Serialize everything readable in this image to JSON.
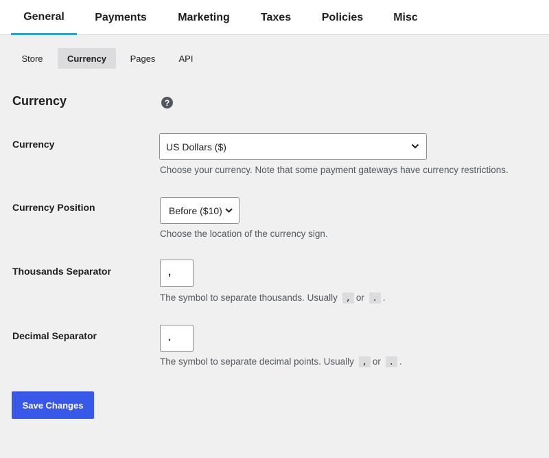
{
  "top_tabs": [
    {
      "label": "General",
      "active": true
    },
    {
      "label": "Payments",
      "active": false
    },
    {
      "label": "Marketing",
      "active": false
    },
    {
      "label": "Taxes",
      "active": false
    },
    {
      "label": "Policies",
      "active": false
    },
    {
      "label": "Misc",
      "active": false
    }
  ],
  "sub_tabs": [
    {
      "label": "Store",
      "active": false
    },
    {
      "label": "Currency",
      "active": true
    },
    {
      "label": "Pages",
      "active": false
    },
    {
      "label": "API",
      "active": false
    }
  ],
  "section": {
    "title": "Currency",
    "help_icon": "question-circle-icon"
  },
  "fields": {
    "currency": {
      "label": "Currency",
      "value": "US Dollars ($)",
      "description": "Choose your currency. Note that some payment gateways have currency restrictions."
    },
    "position": {
      "label": "Currency Position",
      "value": "Before ($10)",
      "description": "Choose the location of the currency sign."
    },
    "thousands": {
      "label": "Thousands Separator",
      "value": ",",
      "description_prefix": "The symbol to separate thousands. Usually",
      "option_a": ",",
      "joiner": "or",
      "option_b": ".",
      "suffix": "."
    },
    "decimal": {
      "label": "Decimal Separator",
      "value": ".",
      "description_prefix": "The symbol to separate decimal points. Usually",
      "option_a": ",",
      "joiner": "or",
      "option_b": ".",
      "suffix": "."
    }
  },
  "save_button": {
    "label": "Save Changes"
  },
  "colors": {
    "accent_tab": "#2ea2cc",
    "primary_button": "#3858e9",
    "page_background": "#f0f0f1"
  }
}
